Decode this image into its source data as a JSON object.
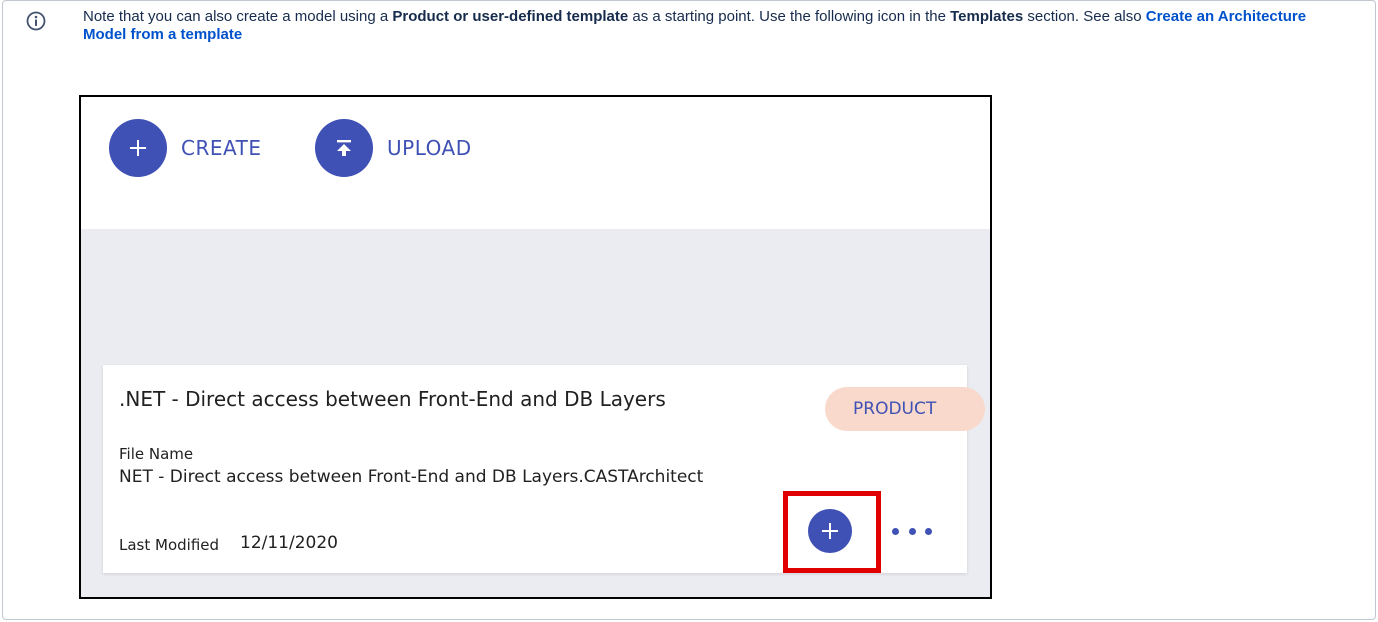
{
  "note": {
    "text_1": "Note that you can also create a model using a ",
    "bold_1": "Product or user-defined template",
    "text_2": " as a starting point. Use the following icon in the ",
    "bold_2": "Templates",
    "text_3": " section. See also ",
    "link": "Create an Architecture Model from a template"
  },
  "screenshot": {
    "create_label": "CREATE",
    "upload_label": "UPLOAD",
    "card": {
      "title": ".NET - Direct access between Front-End and DB Layers",
      "badge": "PRODUCT",
      "file_name_label": "File Name",
      "file_name": "NET - Direct access between Front-End and DB Layers.CASTArchitect",
      "last_modified_label": "Last Modified",
      "last_modified": "12/11/2020"
    }
  },
  "icons": {
    "info": "info-icon",
    "create": "plus-icon",
    "upload": "upload-icon",
    "add": "plus-icon",
    "more": "more-dots-icon"
  },
  "colors": {
    "accent": "#3f51b5",
    "badge_bg": "#f8d9cb",
    "highlight": "#e00000",
    "link": "#0052cc"
  }
}
